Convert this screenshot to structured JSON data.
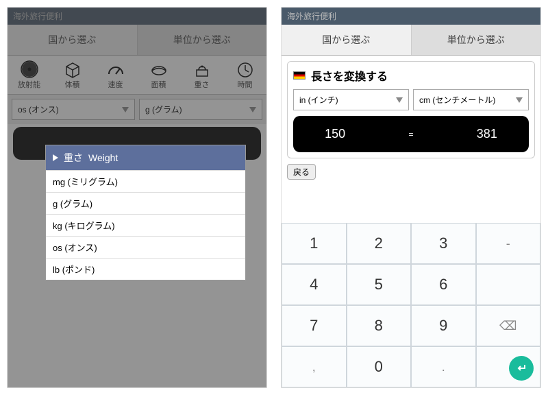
{
  "app_title": "海外旅行便利",
  "tabs": {
    "by_country": "国から選ぶ",
    "by_unit": "単位から選ぶ"
  },
  "screen1": {
    "categories": [
      {
        "name": "radiation-icon",
        "label": "放射能"
      },
      {
        "name": "volume-icon",
        "label": "体積"
      },
      {
        "name": "speed-icon",
        "label": "速度"
      },
      {
        "name": "area-icon",
        "label": "面積"
      },
      {
        "name": "weight-icon",
        "label": "重さ"
      },
      {
        "name": "time-icon",
        "label": "時間"
      }
    ],
    "from_unit": "os (オンス)",
    "to_unit": "g (グラム)",
    "dropdown": {
      "title_jp": "重さ",
      "title_en": "Weight",
      "items": [
        "mg (ミリグラム)",
        "g (グラム)",
        "kg (キログラム)",
        "os (オンス)",
        "lb (ポンド)"
      ]
    }
  },
  "screen2": {
    "title": "長さを変換する",
    "from_unit": "in (インチ)",
    "to_unit": "cm (センチメートル)",
    "from_value": "150",
    "eq": "=",
    "to_value": "381",
    "back": "戻る",
    "keys": {
      "k1": "1",
      "k2": "2",
      "k3": "3",
      "k4": "4",
      "k5": "5",
      "k6": "6",
      "k7": "7",
      "k8": "8",
      "k9": "9",
      "k0": "0",
      "dash": "-",
      "dot": ".",
      "comma": ",",
      "space": " ",
      "bksp": "⌫",
      "enter": "↩"
    }
  }
}
